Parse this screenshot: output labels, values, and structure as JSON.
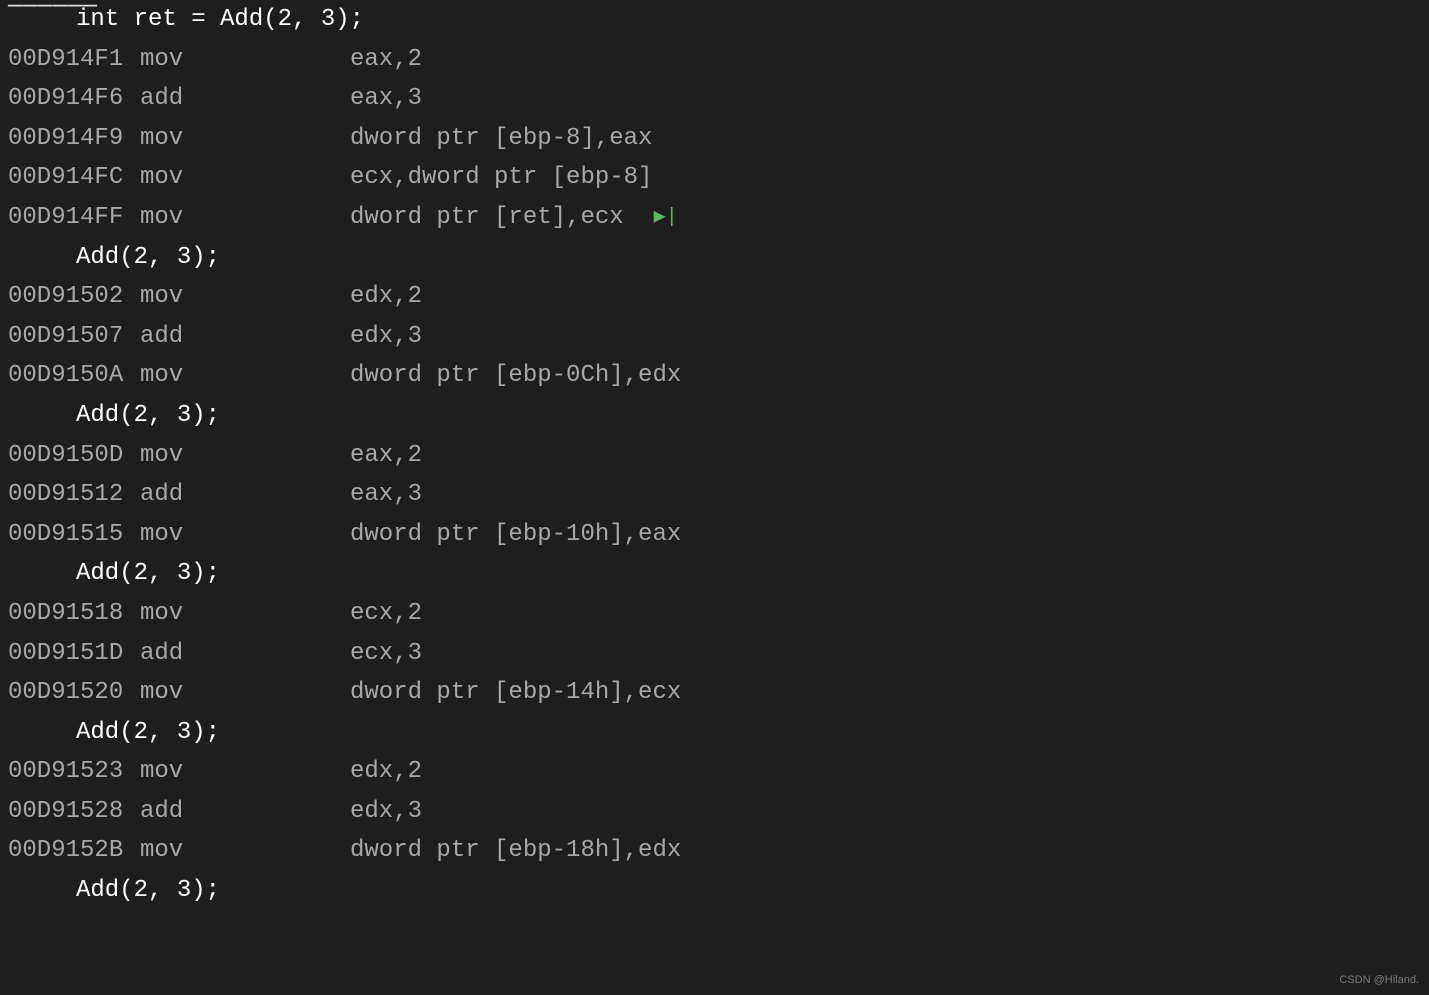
{
  "watermark": "CSDN @Hiland.",
  "marker_glyph": "▶|",
  "lines": [
    {
      "type": "src",
      "text": "int ret = Add(2, 3);"
    },
    {
      "type": "asm",
      "addr": "00D914F1",
      "mnemonic": "mov",
      "operand": "eax,2"
    },
    {
      "type": "asm",
      "addr": "00D914F6",
      "mnemonic": "add",
      "operand": "eax,3"
    },
    {
      "type": "asm",
      "addr": "00D914F9",
      "mnemonic": "mov",
      "operand": "dword ptr [ebp-8],eax"
    },
    {
      "type": "asm",
      "addr": "00D914FC",
      "mnemonic": "mov",
      "operand": "ecx,dword ptr [ebp-8]"
    },
    {
      "type": "asm",
      "addr": "00D914FF",
      "mnemonic": "mov",
      "operand": "dword ptr [ret],ecx",
      "marker": true
    },
    {
      "type": "src",
      "text": "Add(2, 3);"
    },
    {
      "type": "asm",
      "addr": "00D91502",
      "mnemonic": "mov",
      "operand": "edx,2"
    },
    {
      "type": "asm",
      "addr": "00D91507",
      "mnemonic": "add",
      "operand": "edx,3"
    },
    {
      "type": "asm",
      "addr": "00D9150A",
      "mnemonic": "mov",
      "operand": "dword ptr [ebp-0Ch],edx"
    },
    {
      "type": "src",
      "text": "Add(2, 3);"
    },
    {
      "type": "asm",
      "addr": "00D9150D",
      "mnemonic": "mov",
      "operand": "eax,2"
    },
    {
      "type": "asm",
      "addr": "00D91512",
      "mnemonic": "add",
      "operand": "eax,3"
    },
    {
      "type": "asm",
      "addr": "00D91515",
      "mnemonic": "mov",
      "operand": "dword ptr [ebp-10h],eax"
    },
    {
      "type": "src",
      "text": "Add(2, 3);"
    },
    {
      "type": "asm",
      "addr": "00D91518",
      "mnemonic": "mov",
      "operand": "ecx,2"
    },
    {
      "type": "asm",
      "addr": "00D9151D",
      "mnemonic": "add",
      "operand": "ecx,3"
    },
    {
      "type": "asm",
      "addr": "00D91520",
      "mnemonic": "mov",
      "operand": "dword ptr [ebp-14h],ecx"
    },
    {
      "type": "src",
      "text": "Add(2, 3);"
    },
    {
      "type": "asm",
      "addr": "00D91523",
      "mnemonic": "mov",
      "operand": "edx,2"
    },
    {
      "type": "asm",
      "addr": "00D91528",
      "mnemonic": "add",
      "operand": "edx,3"
    },
    {
      "type": "asm",
      "addr": "00D9152B",
      "mnemonic": "mov",
      "operand": "dword ptr [ebp-18h],edx"
    },
    {
      "type": "src",
      "text": "Add(2, 3);"
    }
  ]
}
